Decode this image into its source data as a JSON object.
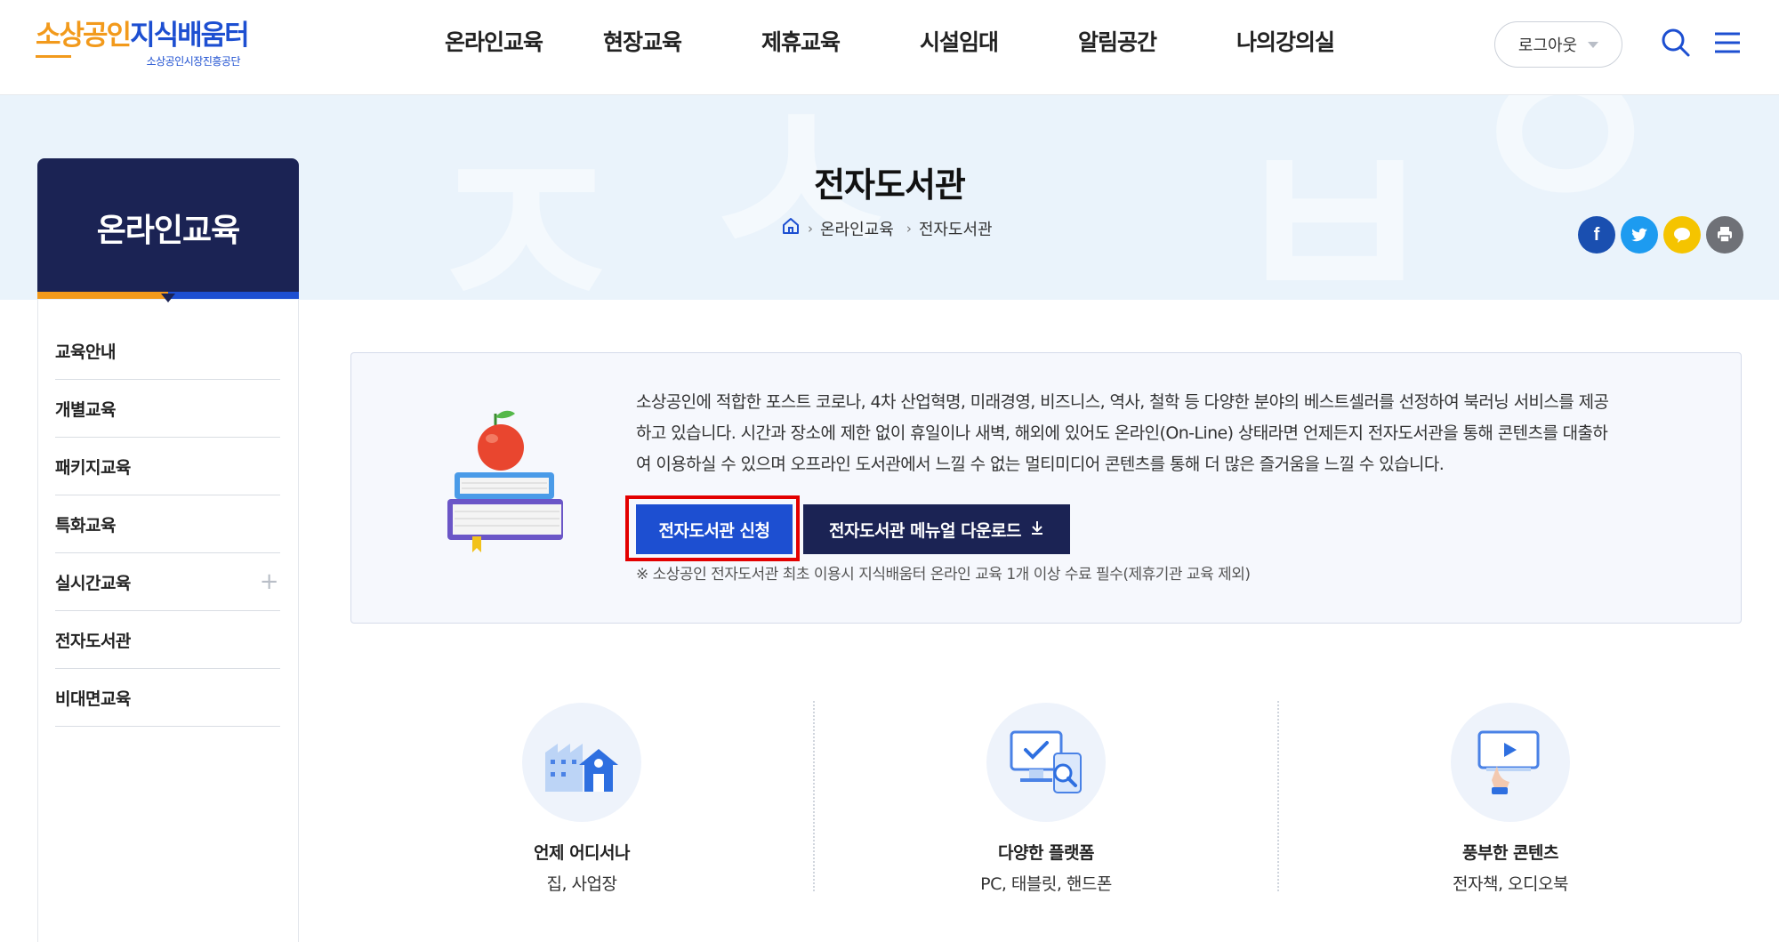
{
  "header": {
    "logo": {
      "part1": "소상공인",
      "part2": "지식배움터",
      "sub": "소상공인시장진흥공단"
    },
    "nav": [
      "온라인교육",
      "현장교육",
      "제휴교육",
      "시설임대",
      "알림공간",
      "나의강의실"
    ],
    "logout_label": "로그아웃",
    "icons": [
      "search-icon",
      "hamburger-menu-icon"
    ]
  },
  "hero": {
    "title": "전자도서관",
    "breadcrumb": [
      "온라인교육",
      "전자도서관"
    ],
    "share_icons": [
      {
        "name": "facebook-icon",
        "color": "#1a4fb0"
      },
      {
        "name": "twitter-icon",
        "color": "#1d9bf0"
      },
      {
        "name": "kakaotalk-icon",
        "color": "#f5c400"
      },
      {
        "name": "print-icon",
        "color": "#6f7177"
      }
    ]
  },
  "sidebar": {
    "title": "온라인교육",
    "items": [
      {
        "label": "교육안내"
      },
      {
        "label": "개별교육"
      },
      {
        "label": "패키지교육"
      },
      {
        "label": "특화교육"
      },
      {
        "label": "실시간교육",
        "expand": "+"
      },
      {
        "label": "전자도서관"
      },
      {
        "label": "비대면교육"
      }
    ]
  },
  "intro": {
    "lines": [
      "소상공인에 적합한 포스트 코로나, 4차 산업혁명, 미래경영, 비즈니스, 역사, 철학 등 다양한 분야의 베스트셀러를 선정하여 북러닝 서비스를 제공",
      "하고 있습니다. 시간과 장소에 제한 없이 휴일이나 새벽, 해외에 있어도 온라인(On-Line) 상태라면 언제든지 전자도서관을 통해 콘텐츠를 대출하",
      "여 이용하실 수 있으며 오프라인 도서관에서 느낄 수 없는 멀티미디어 콘텐츠를 통해 더 많은 즐거움을 느낄 수 있습니다."
    ],
    "apply_button": "전자도서관 신청",
    "manual_button": "전자도서관 메뉴얼 다운로드",
    "notice": "※ 소상공인 전자도서관 최초 이용시 지식배움터 온라인 교육 1개 이상 수료 필수(제휴기관 교육 제외)"
  },
  "features": [
    {
      "title": "언제 어디서나",
      "sub": "집, 사업장",
      "icon": "factory-house-icon"
    },
    {
      "title": "다양한 플랫폼",
      "sub": "PC, 태블릿, 핸드폰",
      "icon": "multi-device-icon"
    },
    {
      "title": "풍부한 콘텐츠",
      "sub": "전자책, 오디오북",
      "icon": "video-content-icon"
    }
  ],
  "colors": {
    "brand_blue": "#1d4fd1",
    "brand_orange": "#f29a1c",
    "navy": "#1b2354",
    "highlight_red": "#e30000"
  }
}
